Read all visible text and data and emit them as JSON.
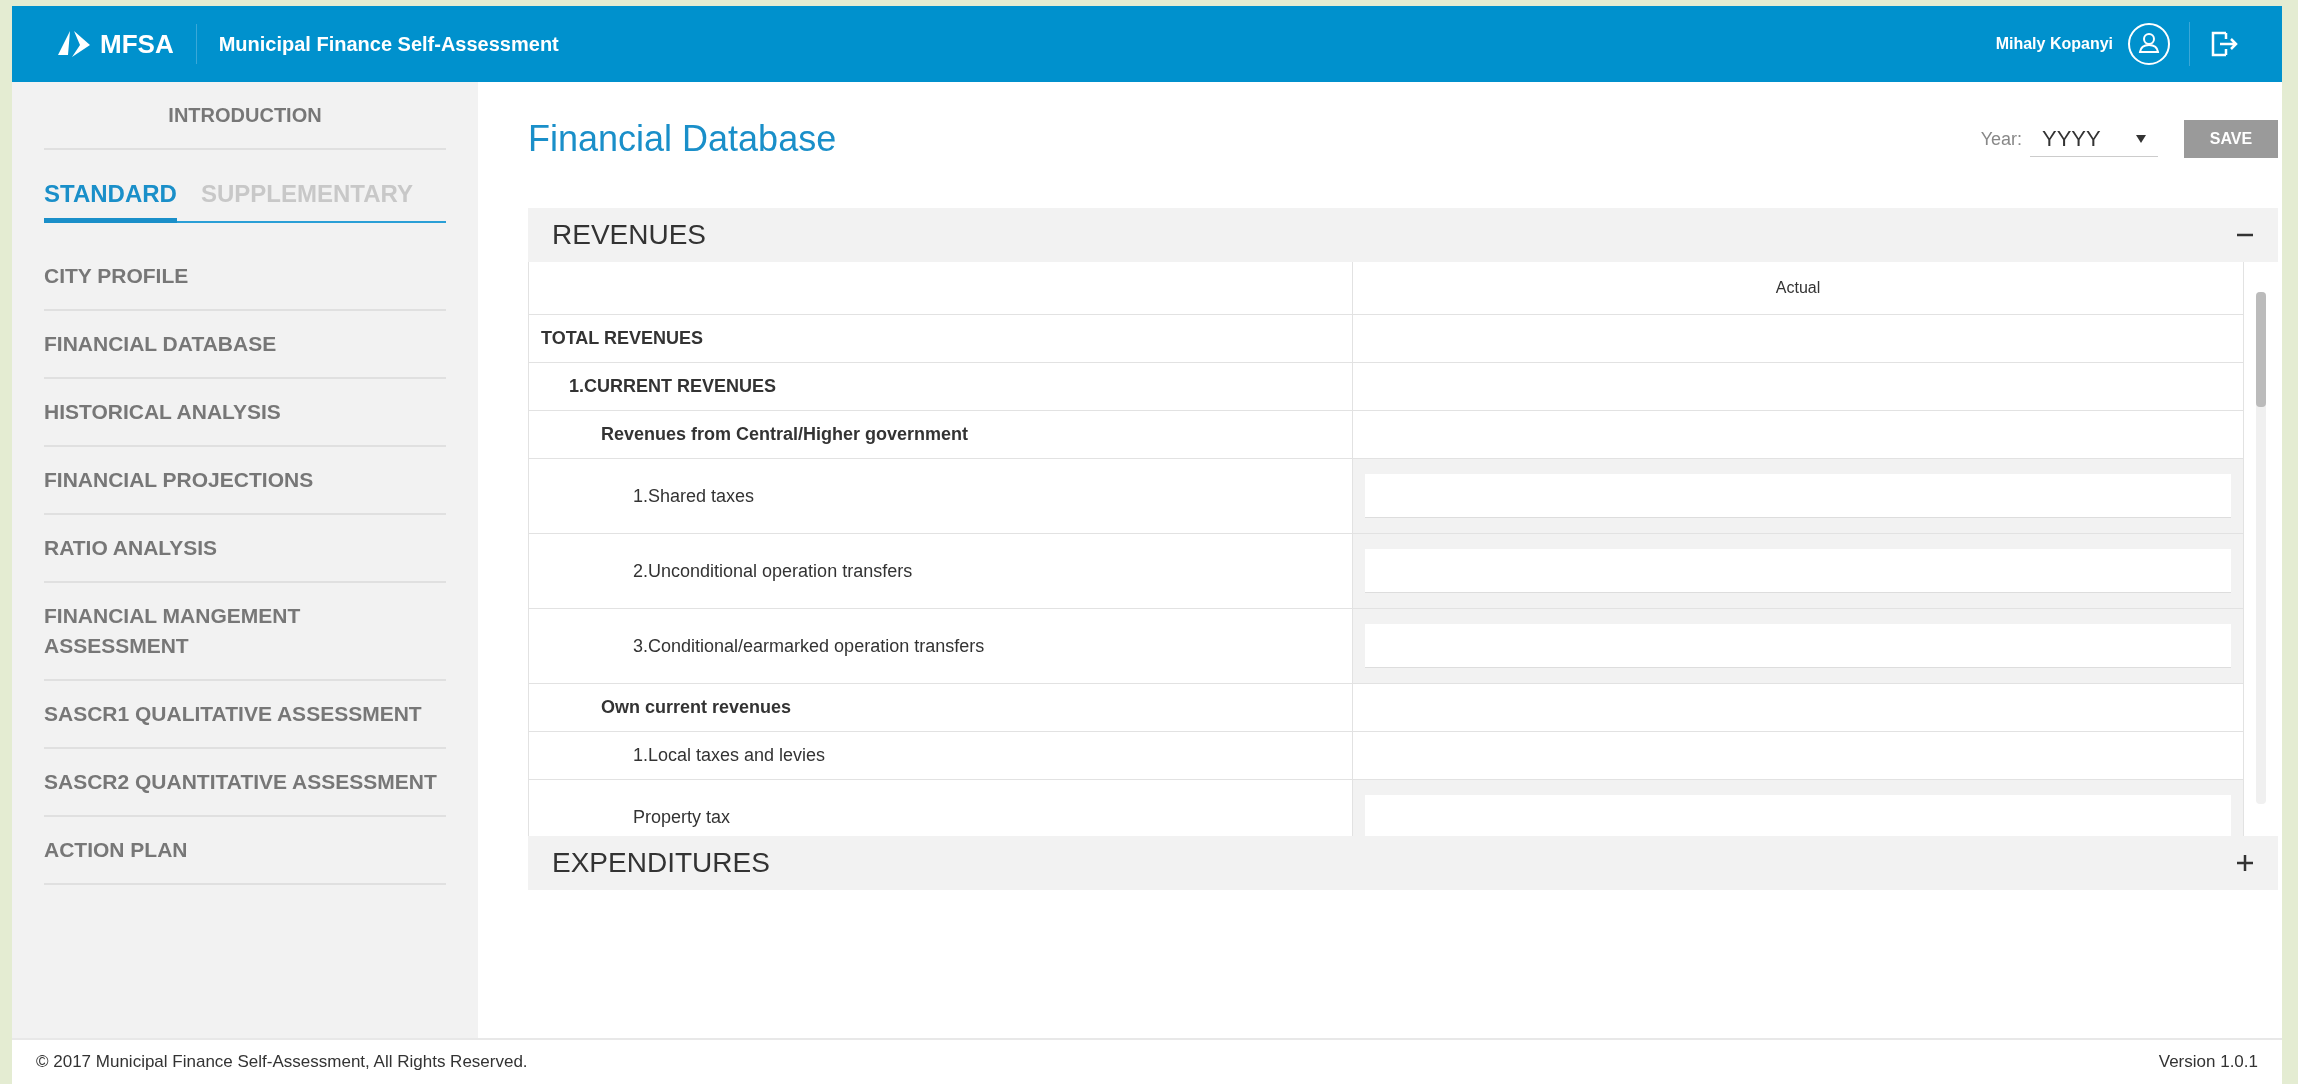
{
  "header": {
    "logo": "MFSA",
    "app_title": "Municipal Finance Self-Assessment",
    "user": "Mihaly Kopanyi"
  },
  "sidebar": {
    "intro": "INTRODUCTION",
    "tabs": [
      {
        "label": "STANDARD",
        "selected": true
      },
      {
        "label": "SUPPLEMENTARY",
        "selected": false
      }
    ],
    "items": [
      "CITY PROFILE",
      "FINANCIAL DATABASE",
      "HISTORICAL ANALYSIS",
      "FINANCIAL PROJECTIONS",
      "RATIO ANALYSIS",
      "FINANCIAL MANGEMENT ASSESSMENT",
      "SASCR1 QUALITATIVE ASSESSMENT",
      "SASCR2 QUANTITATIVE ASSESSMENT",
      "ACTION PLAN"
    ]
  },
  "page": {
    "title": "Financial Database",
    "year_label": "Year:",
    "year_value": "YYYY",
    "save": {
      "label": "SAVE",
      "disabled": true
    }
  },
  "sections": [
    {
      "title": "REVENUES",
      "expanded": true,
      "column": "Actual",
      "rows": [
        {
          "label": "TOTAL REVENUES",
          "kind": "heading",
          "children": [
            {
              "label": "1.CURRENT REVENUES",
              "kind": "heading",
              "children": [
                {
                  "label": "Revenues from Central/Higher government",
                  "kind": "heading",
                  "children": [
                    {
                      "label": "1.Shared taxes",
                      "kind": "input"
                    },
                    {
                      "label": "2.Unconditional operation transfers",
                      "kind": "input"
                    },
                    {
                      "label": "3.Conditional/earmarked operation transfers",
                      "kind": "input"
                    }
                  ]
                },
                {
                  "label": "Own current revenues",
                  "kind": "heading",
                  "children": [
                    {
                      "label": "1.Local taxes and levies",
                      "kind": "label",
                      "children": [
                        {
                          "label": "Property tax",
                          "kind": "input"
                        }
                      ]
                    }
                  ]
                }
              ]
            }
          ]
        }
      ]
    },
    {
      "title": "EXPENDITURES",
      "expanded": false
    }
  ],
  "footer": {
    "copyright": "© 2017 Municipal Finance Self-Assessment, All Rights Reserved.",
    "version": "Version 1.0.1"
  }
}
